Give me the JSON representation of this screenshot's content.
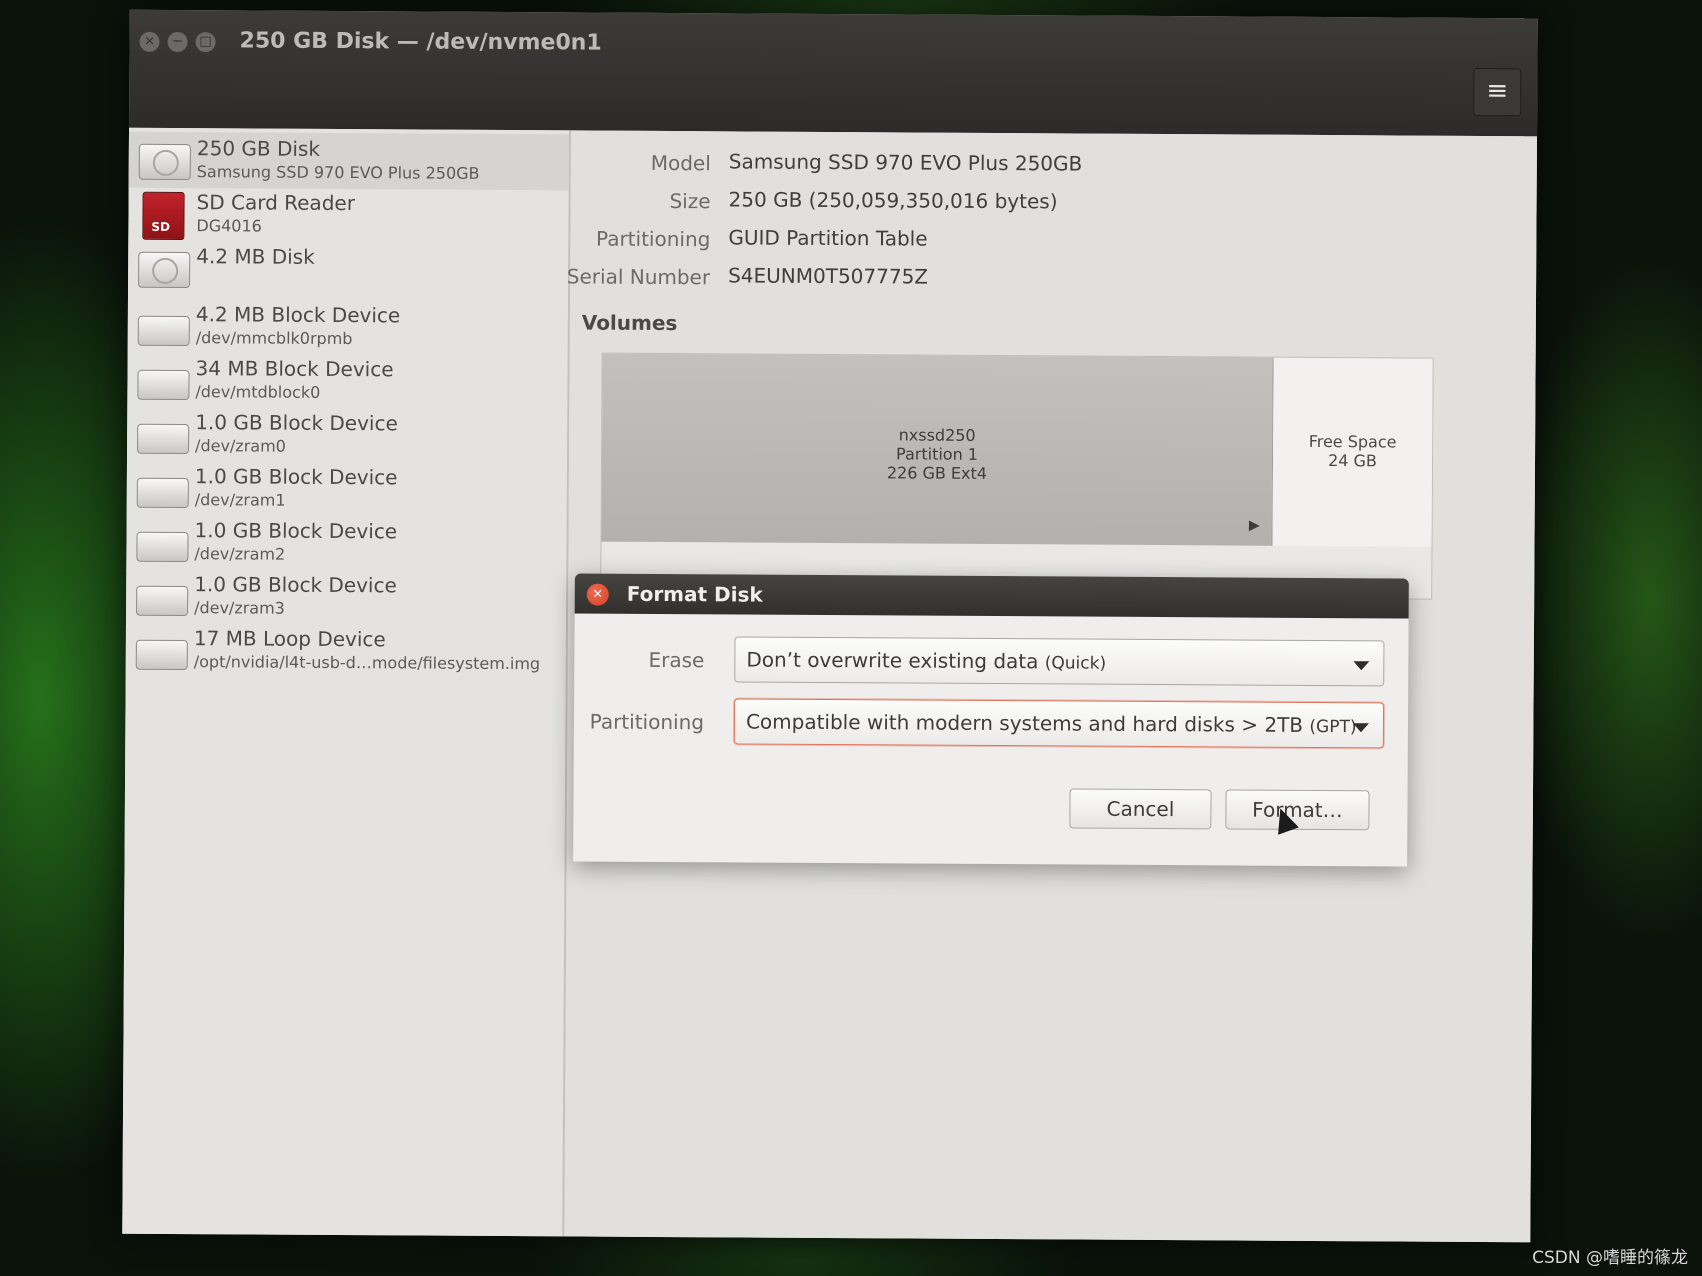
{
  "window": {
    "title": "250 GB Disk — /dev/nvme0n1",
    "controls": {
      "close": "×",
      "minimize": "−",
      "maximize": "□"
    },
    "menu_icon": "hamburger-menu-icon",
    "menu_glyph": "≡"
  },
  "sidebar": {
    "items": [
      {
        "name": "250 GB Disk",
        "sub": "Samsung SSD 970 EVO Plus 250GB",
        "icon": "hard-disk-icon",
        "selected": true
      },
      {
        "name": "SD Card Reader",
        "sub": "DG4016",
        "icon": "sd-card-icon",
        "badge": "SD"
      },
      {
        "name": "4.2 MB Disk",
        "sub": "",
        "icon": "hard-disk-icon"
      },
      {
        "name": "4.2 MB Block Device",
        "sub": "/dev/mmcblk0rpmb",
        "icon": "block-device-icon"
      },
      {
        "name": "34 MB Block Device",
        "sub": "/dev/mtdblock0",
        "icon": "block-device-icon"
      },
      {
        "name": "1.0 GB Block Device",
        "sub": "/dev/zram0",
        "icon": "block-device-icon"
      },
      {
        "name": "1.0 GB Block Device",
        "sub": "/dev/zram1",
        "icon": "block-device-icon"
      },
      {
        "name": "1.0 GB Block Device",
        "sub": "/dev/zram2",
        "icon": "block-device-icon"
      },
      {
        "name": "1.0 GB Block Device",
        "sub": "/dev/zram3",
        "icon": "block-device-icon"
      },
      {
        "name": "17 MB Loop Device",
        "sub": "/opt/nvidia/l4t-usb-d…mode/filesystem.img",
        "icon": "block-device-icon"
      }
    ]
  },
  "details": {
    "model_label": "Model",
    "model": "Samsung SSD 970 EVO Plus 250GB",
    "size_label": "Size",
    "size": "250 GB (250,059,350,016 bytes)",
    "partitioning_label": "Partitioning",
    "partitioning": "GUID Partition Table",
    "serial_label": "Serial Number",
    "serial": "S4EUNM0T507775Z"
  },
  "volumes": {
    "heading": "Volumes",
    "partition": {
      "name": "nxssd250",
      "number": "Partition 1",
      "info": "226 GB Ext4"
    },
    "free": {
      "label": "Free Space",
      "size": "24 GB"
    },
    "scroll_glyph": "▶"
  },
  "dialog": {
    "title": "Format Disk",
    "close_glyph": "×",
    "erase_label": "Erase",
    "erase_value": "Don’t overwrite existing data",
    "erase_suffix": "(Quick)",
    "partitioning_label": "Partitioning",
    "partitioning_value": "Compatible with modern systems and hard disks > 2TB",
    "partitioning_suffix": "(GPT)",
    "cancel_label": "Cancel",
    "format_label": "Format…",
    "accent_color": "#e0735b"
  },
  "watermark": "CSDN @嗜睡的篠龙"
}
